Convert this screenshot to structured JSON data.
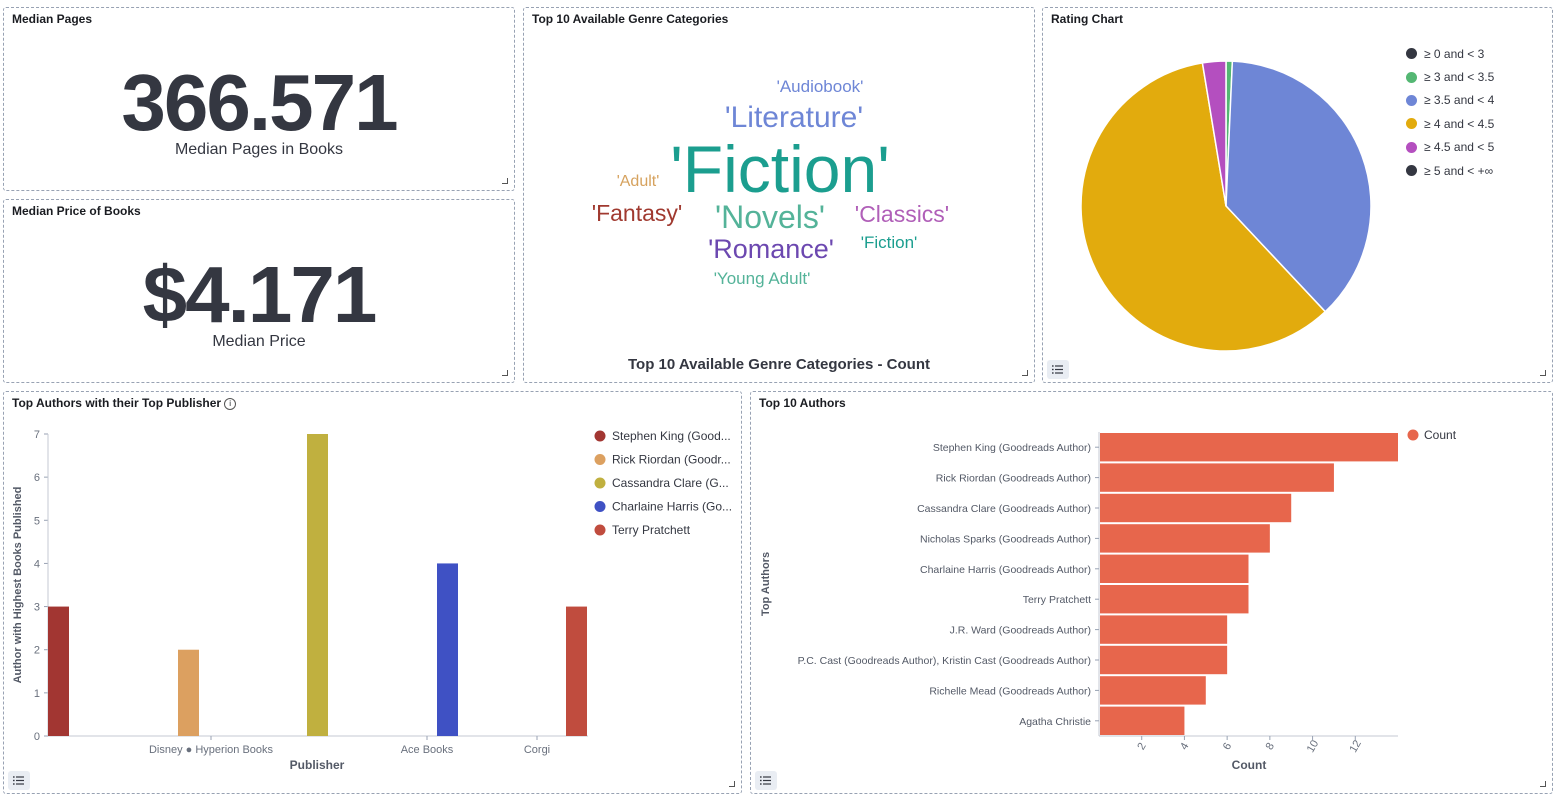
{
  "panels": {
    "median_pages": {
      "title": "Median Pages",
      "value": "366.571",
      "label": "Median Pages in Books"
    },
    "median_price": {
      "title": "Median Price of Books",
      "value": "$4.171",
      "label": "Median Price"
    },
    "genres": {
      "title": "Top 10 Available Genre Categories",
      "caption": "Top 10 Available Genre Categories - Count",
      "words": [
        {
          "text": "'Audiobook'",
          "color": "#6e86d6"
        },
        {
          "text": "'Literature'",
          "color": "#6e86d6"
        },
        {
          "text": "'Fiction'",
          "color": "#1b9e8f"
        },
        {
          "text": "'Adult'",
          "color": "#d6a25e"
        },
        {
          "text": "'Fantasy'",
          "color": "#a0392f"
        },
        {
          "text": "'Novels'",
          "color": "#54b399"
        },
        {
          "text": "'Classics'",
          "color": "#b05fb8"
        },
        {
          "text": "'Romance'",
          "color": "#6c48b0"
        },
        {
          "text": "'Fiction'",
          "color": "#1b9e8f"
        },
        {
          "text": "'Young Adult'",
          "color": "#54b399"
        }
      ]
    },
    "rating": {
      "title": "Rating Chart",
      "legend": [
        {
          "label": "≥ 0 and < 3",
          "color": "#343741"
        },
        {
          "label": "≥ 3 and < 3.5",
          "color": "#54b773"
        },
        {
          "label": "≥ 3.5 and < 4",
          "color": "#6e86d6"
        },
        {
          "label": "≥ 4 and < 4.5",
          "color": "#e2ab0d"
        },
        {
          "label": "≥ 4.5 and < 5",
          "color": "#b44fbf"
        },
        {
          "label": "≥ 5 and < +∞",
          "color": "#343741"
        }
      ]
    },
    "authors_publisher": {
      "title": "Top Authors with their Top Publisher",
      "info_icon": "info-icon"
    },
    "top_authors": {
      "title": "Top 10 Authors"
    }
  },
  "chart_data": [
    {
      "type": "pie",
      "title": "Rating Chart",
      "slices": [
        {
          "label": "≥ 3 and < 3.5",
          "value": 0.7,
          "color": "#54b773"
        },
        {
          "label": "≥ 3.5 and < 4",
          "value": 37.3,
          "color": "#6e86d6"
        },
        {
          "label": "≥ 4 and < 4.5",
          "value": 59.4,
          "color": "#e2ab0d"
        },
        {
          "label": "≥ 4.5 and < 5",
          "value": 2.6,
          "color": "#b44fbf"
        }
      ]
    },
    {
      "type": "bar",
      "title": "Top Authors with their Top Publisher",
      "xlabel": "Publisher",
      "ylabel": "Author with Highest Books Published",
      "ylim": [
        0,
        7
      ],
      "yticks": [
        0,
        1,
        2,
        3,
        4,
        5,
        6,
        7
      ],
      "x_tick_labels": [
        "Disney ● Hyperion Books",
        "Ace Books",
        "Corgi"
      ],
      "series": [
        {
          "name": "Stephen King (Good...",
          "color": "#a23632",
          "values": [
            3
          ]
        },
        {
          "name": "Rick Riordan (Goodr...",
          "color": "#dca060",
          "values": [
            2
          ]
        },
        {
          "name": "Cassandra Clare (G...",
          "color": "#c0b03f",
          "values": [
            7
          ]
        },
        {
          "name": "Charlaine Harris (Go...",
          "color": "#3f51c4",
          "values": [
            4
          ]
        },
        {
          "name": "Terry Pratchett",
          "color": "#c04c3e",
          "values": [
            3
          ]
        }
      ]
    },
    {
      "type": "bar",
      "orientation": "horizontal",
      "title": "Top 10 Authors",
      "xlabel": "Count",
      "ylabel": "Top Authors",
      "legend": [
        "Count"
      ],
      "color": "#e7664c",
      "xticks": [
        2,
        4,
        6,
        8,
        10,
        12
      ],
      "categories": [
        "Stephen King (Goodreads Author)",
        "Rick Riordan (Goodreads Author)",
        "Cassandra Clare (Goodreads Author)",
        "Nicholas Sparks (Goodreads Author)",
        "Charlaine Harris (Goodreads Author)",
        "Terry Pratchett",
        "J.R. Ward (Goodreads Author)",
        "P.C. Cast (Goodreads Author), Kristin Cast (Goodreads Author)",
        "Richelle Mead (Goodreads Author)",
        "Agatha Christie"
      ],
      "values": [
        14,
        11,
        9,
        8,
        7,
        7,
        6,
        6,
        5,
        4
      ]
    }
  ]
}
